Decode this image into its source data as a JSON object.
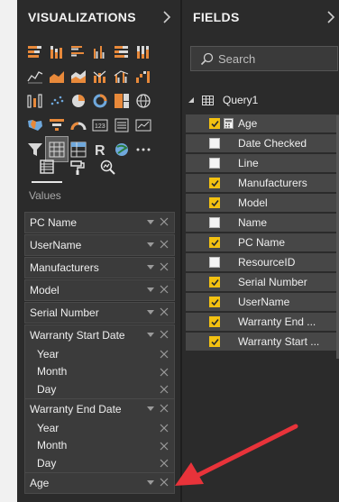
{
  "visualizations": {
    "title": "VISUALIZATIONS",
    "grid": [
      [
        "stacked-bar-icon",
        "stacked-column-icon",
        "clustered-bar-icon",
        "clustered-column-icon",
        "100pct-bar-icon",
        "100pct-column-icon"
      ],
      [
        "line-chart-icon",
        "area-chart-icon",
        "stacked-area-icon",
        "line-column-icon",
        "line-clustered-column-icon",
        "waterfall-icon"
      ],
      [
        "ribbon-chart-icon",
        "scatter-chart-icon",
        "pie-chart-icon",
        "donut-chart-icon",
        "treemap-icon",
        "globe-map-icon"
      ],
      [
        "filled-map-icon",
        "funnel-icon",
        "gauge-icon",
        "card-icon",
        "multi-row-card-icon",
        "kpi-icon"
      ],
      [
        "slicer-icon",
        "table-icon",
        "matrix-icon",
        "r-visual-icon",
        "arcgis-icon",
        "more-options-icon"
      ]
    ],
    "tabs": [
      "fields-tab-icon",
      "format-tab-icon",
      "analytics-tab-icon"
    ],
    "values_label": "Values",
    "wells": [
      {
        "label": "PC Name"
      },
      {
        "label": "UserName"
      },
      {
        "label": "Manufacturers"
      },
      {
        "label": "Model"
      },
      {
        "label": "Serial Number"
      },
      {
        "label": "Warranty Start Date",
        "children": [
          "Year",
          "Month",
          "Day"
        ]
      },
      {
        "label": "Warranty End Date",
        "children": [
          "Year",
          "Month",
          "Day"
        ]
      },
      {
        "label": "Age"
      }
    ]
  },
  "fields": {
    "title": "FIELDS",
    "search_placeholder": "Search",
    "table_name": "Query1",
    "items": [
      {
        "label": "Age",
        "checked": true,
        "calculated": true
      },
      {
        "label": "Date Checked",
        "checked": false
      },
      {
        "label": "Line",
        "checked": false
      },
      {
        "label": "Manufacturers",
        "checked": true
      },
      {
        "label": "Model",
        "checked": true
      },
      {
        "label": "Name",
        "checked": false
      },
      {
        "label": "PC Name",
        "checked": true
      },
      {
        "label": "ResourceID",
        "checked": false
      },
      {
        "label": "Serial Number",
        "checked": true
      },
      {
        "label": "UserName",
        "checked": true
      },
      {
        "label": "Warranty End ...",
        "checked": true
      },
      {
        "label": "Warranty Start ...",
        "checked": true
      }
    ]
  },
  "colors": {
    "checkbox_checked": "#f3c111",
    "arrow": "#e8333a",
    "pane_bg": "#2b2b2b",
    "row_bg": "#474747"
  }
}
